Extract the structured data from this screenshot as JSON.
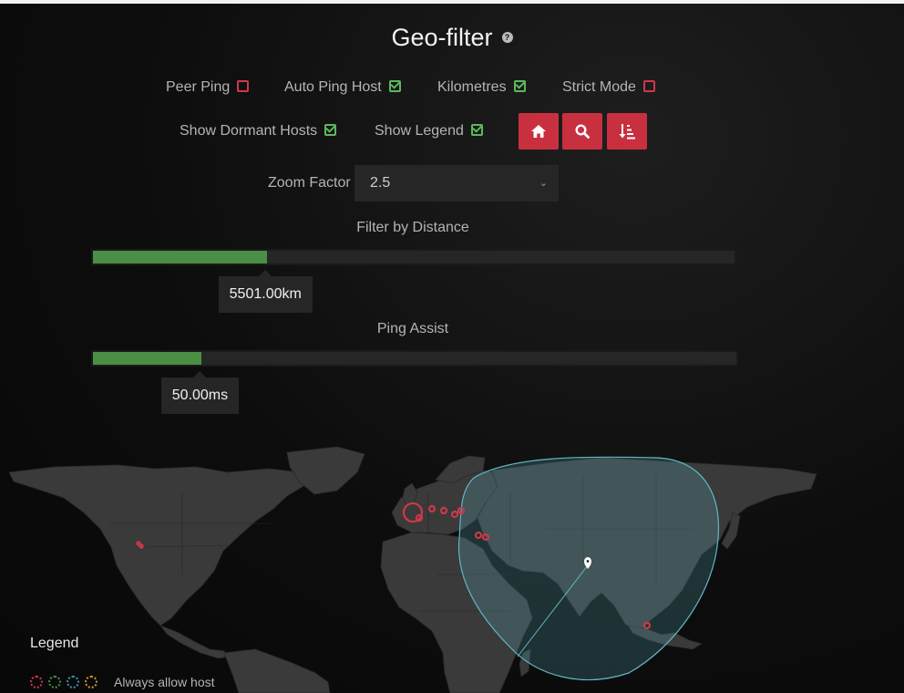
{
  "header": {
    "title": "Geo-filter",
    "help_icon": "question-circle-icon",
    "help_glyph": "?"
  },
  "options": [
    {
      "label": "Peer Ping",
      "checked": false
    },
    {
      "label": "Auto Ping Host",
      "checked": true
    },
    {
      "label": "Kilometres",
      "checked": true
    },
    {
      "label": "Strict Mode",
      "checked": false
    },
    {
      "label": "Show Dormant Hosts",
      "checked": true
    },
    {
      "label": "Show Legend",
      "checked": true
    }
  ],
  "toolbar": {
    "buttons": [
      "home-icon",
      "search-icon",
      "sort-amount-icon"
    ],
    "color": "#c9303f"
  },
  "zoom": {
    "label": "Zoom Factor",
    "value": "2.5"
  },
  "distance": {
    "label": "Filter by Distance",
    "value_text": "5501.00km",
    "fraction": 0.27
  },
  "ping": {
    "label": "Ping Assist",
    "value_text": "50.00ms",
    "fraction": 0.168
  },
  "legend": {
    "title": "Legend",
    "items": [
      {
        "label": "Always allow host"
      }
    ],
    "dot_colors": [
      "#d0374a",
      "#4a8f45",
      "#3a8fb7",
      "#c9922f"
    ]
  },
  "colors": {
    "accent": "#c9303f",
    "fill": "#4a8f45",
    "range": "#5fb8c4",
    "host": "#d0374a"
  }
}
